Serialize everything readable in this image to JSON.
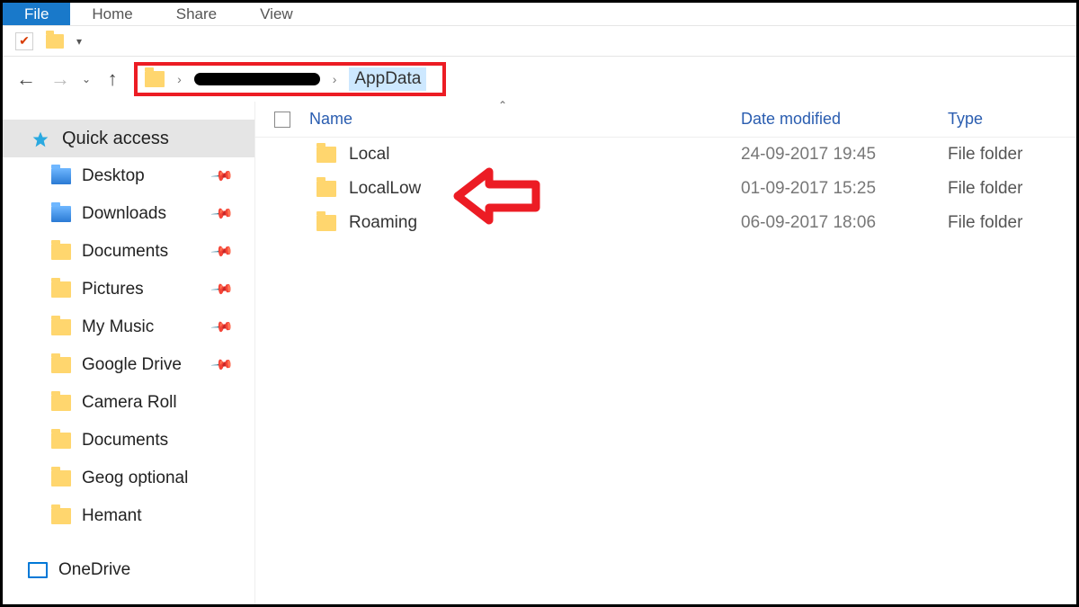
{
  "ribbon": {
    "tabs": [
      {
        "label": "File",
        "active": true
      },
      {
        "label": "Home",
        "active": false
      },
      {
        "label": "Share",
        "active": false
      },
      {
        "label": "View",
        "active": false
      }
    ]
  },
  "breadcrumb": {
    "redacted_segment": true,
    "current": "AppData"
  },
  "sidebar": {
    "quick_access_label": "Quick access",
    "onedrive_label": "OneDrive",
    "items": [
      {
        "label": "Desktop",
        "pinned": true
      },
      {
        "label": "Downloads",
        "pinned": true
      },
      {
        "label": "Documents",
        "pinned": true
      },
      {
        "label": "Pictures",
        "pinned": true
      },
      {
        "label": "My Music",
        "pinned": true
      },
      {
        "label": "Google Drive",
        "pinned": true
      },
      {
        "label": "Camera Roll",
        "pinned": false
      },
      {
        "label": "Documents",
        "pinned": false
      },
      {
        "label": "Geog optional",
        "pinned": false
      },
      {
        "label": "Hemant",
        "pinned": false
      }
    ]
  },
  "columns": {
    "name": "Name",
    "date": "Date modified",
    "type": "Type"
  },
  "rows": [
    {
      "name": "Local",
      "date": "24-09-2017 19:45",
      "type": "File folder"
    },
    {
      "name": "LocalLow",
      "date": "01-09-2017 15:25",
      "type": "File folder"
    },
    {
      "name": "Roaming",
      "date": "06-09-2017 18:06",
      "type": "File folder"
    }
  ],
  "annotation": {
    "address_bar_highlighted": true,
    "arrow_points_to_row_index": 1
  }
}
